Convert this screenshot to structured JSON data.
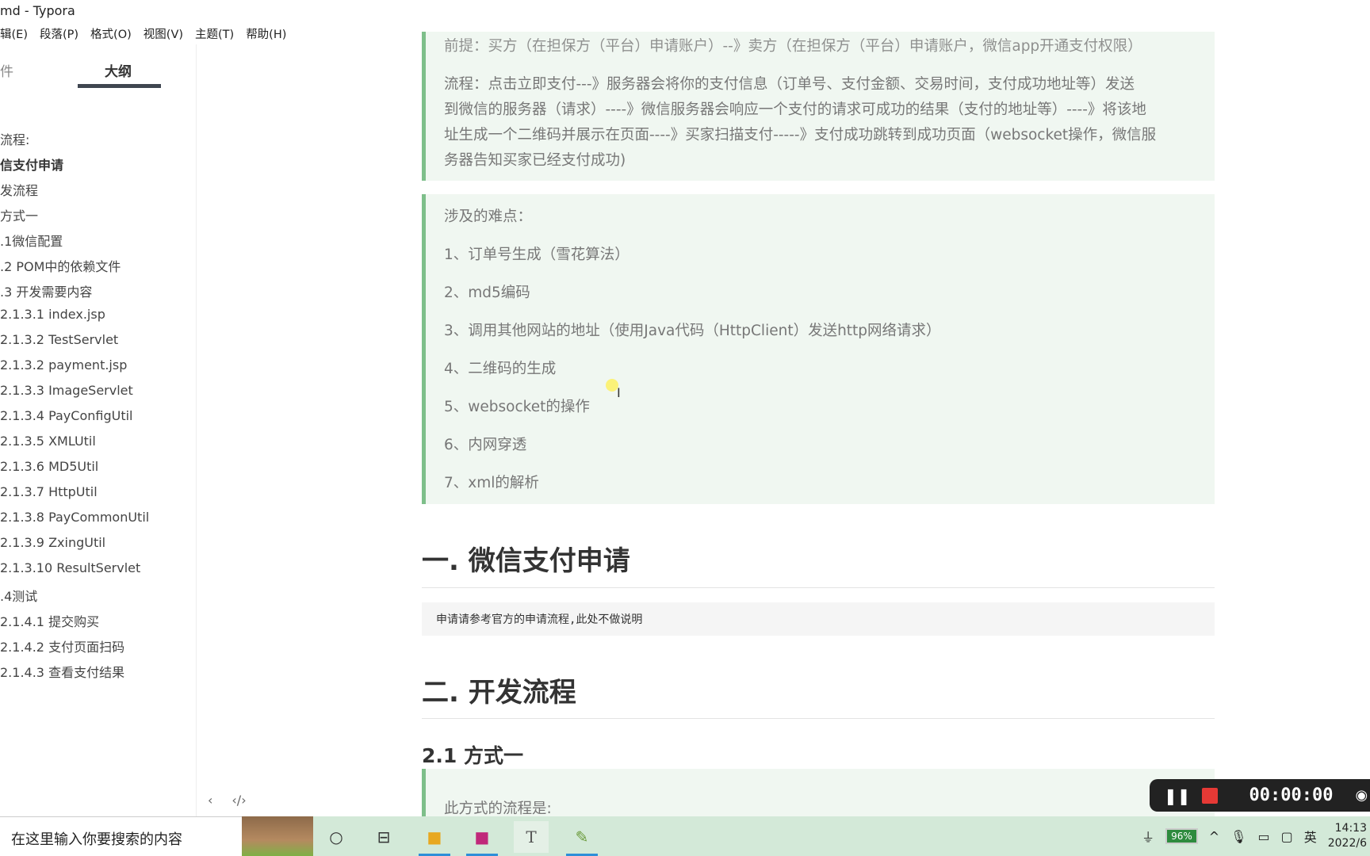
{
  "window": {
    "title": "md - Typora"
  },
  "menu": [
    "辑(E)",
    "段落(P)",
    "格式(O)",
    "视图(V)",
    "主题(T)",
    "帮助(H)"
  ],
  "sidebar": {
    "tab_files": "件",
    "tab_outline": "大纲",
    "outline": [
      "流程:",
      "信支付申请",
      "发流程",
      "方式一",
      ".1微信配置",
      ".2 POM中的依赖文件",
      ".3 开发需要内容",
      "2.1.3.1 index.jsp",
      "2.1.3.2 TestServlet",
      "2.1.3.2 payment.jsp",
      "2.1.3.3 ImageServlet",
      "2.1.3.4 PayConfigUtil",
      "2.1.3.5 XMLUtil",
      "2.1.3.6 MD5Util",
      "2.1.3.7 HttpUtil",
      "2.1.3.8 PayCommonUtil",
      "2.1.3.9 ZxingUtil",
      "2.1.3.10 ResultServlet",
      ".4测试",
      "2.1.4.1 提交购买",
      "2.1.4.2 支付页面扫码",
      "2.1.4.3 查看支付结果"
    ],
    "active_index": 1,
    "back": "‹",
    "source": "‹/›"
  },
  "content": {
    "quote1": [
      "前提：买方（在担保方（平台）申请账户）--》卖方（在担保方（平台）申请账户，微信app开通支付权限）",
      "流程：点击立即支付---》服务器会将你的支付信息（订单号、支付金额、交易时间，支付成功地址等）发送",
      "到微信的服务器（请求）----》微信服务器会响应一个支付的请求可成功的结果（支付的地址等）----》将该地",
      "址生成一个二维码并展示在页面----》买家扫描支付-----》支付成功跳转到成功页面（websocket操作，微信服",
      "务器告知买家已经支付成功)"
    ],
    "quote2": [
      "涉及的难点：",
      "1、订单号生成（雪花算法）",
      "2、md5编码",
      "3、调用其他网站的地址（使用Java代码（HttpClient）发送http网络请求）",
      "4、二维码的生成",
      "5、websocket的操作",
      "6、内网穿透",
      "7、xml的解析"
    ],
    "h1_1": "一. 微信支付申请",
    "code": "申请请参考官方的申请流程,此处不做说明",
    "h1_2": "二. 开发流程",
    "h2": "2.1 方式一",
    "quote3": "此方式的流程是:"
  },
  "taskbar": {
    "search_placeholder": "在这里输入你要搜索的内容",
    "typora_icon": "T"
  },
  "recorder": {
    "time": "00:00:00"
  },
  "tray": {
    "battery": "96%",
    "ime": "英",
    "time": "14:13",
    "date": "2022/6"
  }
}
